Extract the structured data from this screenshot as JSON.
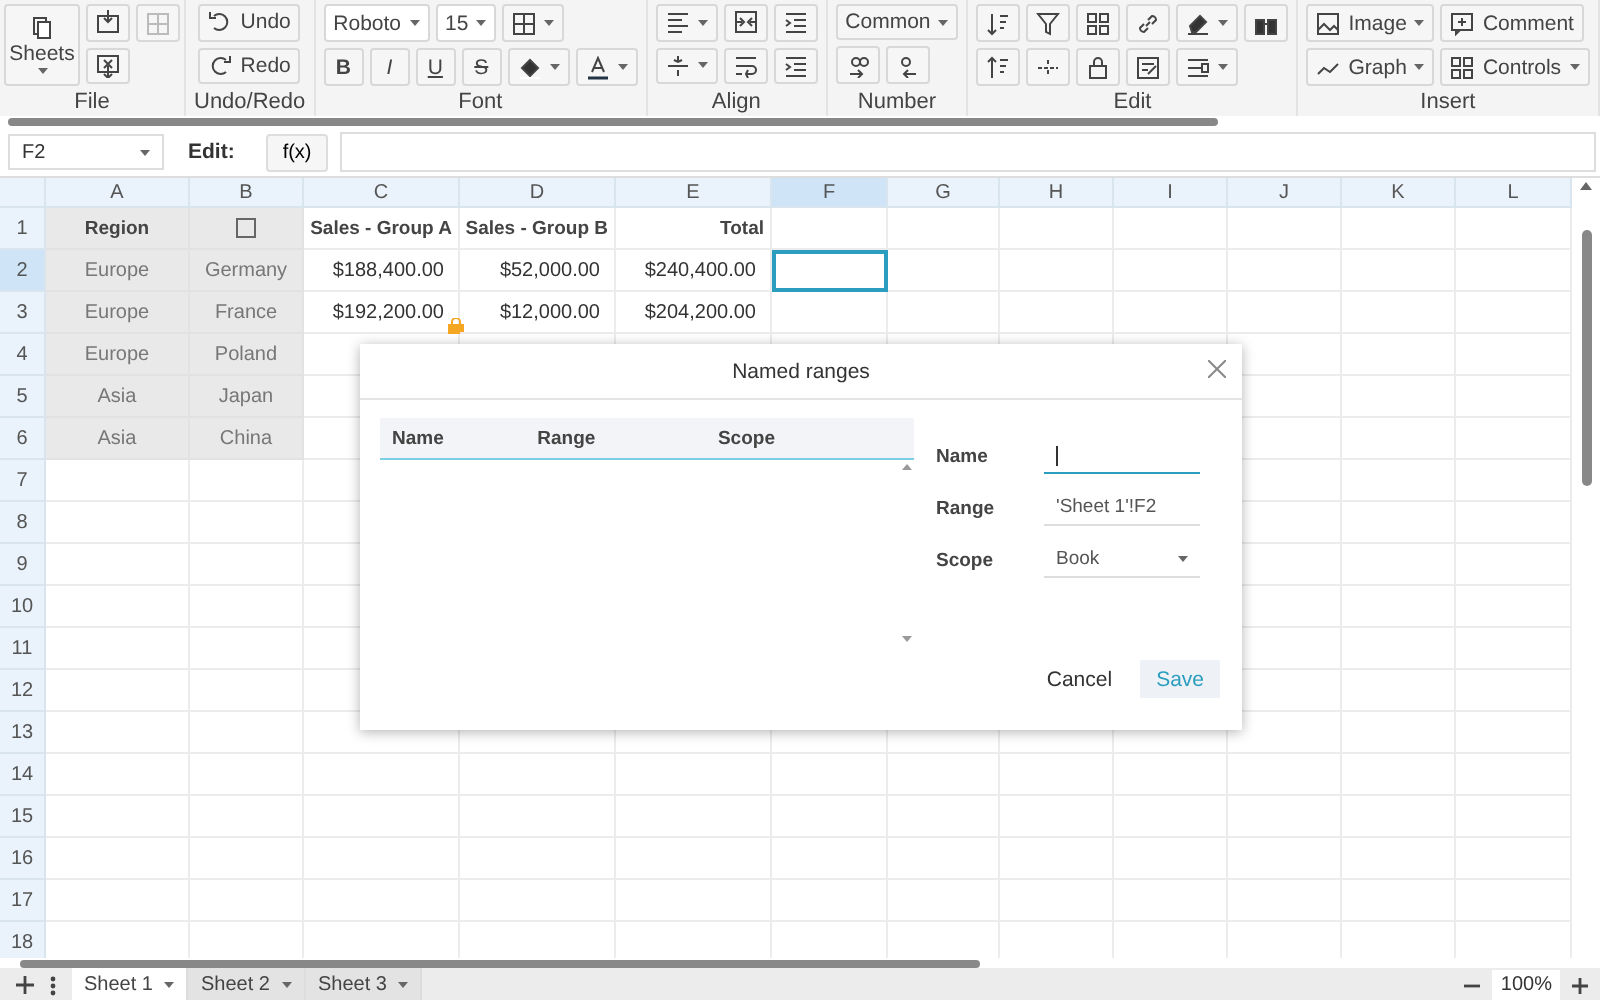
{
  "toolbar": {
    "file": {
      "label": "File",
      "sheets": "Sheets"
    },
    "undo_redo": {
      "label": "Undo/Redo",
      "undo": "Undo",
      "redo": "Redo"
    },
    "font": {
      "label": "Font",
      "family": "Roboto",
      "size": "15",
      "bold": "B",
      "italic": "I",
      "underline": "U",
      "strike": "S"
    },
    "align": {
      "label": "Align"
    },
    "number": {
      "label": "Number",
      "format": "Common"
    },
    "edit": {
      "label": "Edit"
    },
    "insert": {
      "label": "Insert",
      "image": "Image",
      "comment": "Comment",
      "graph": "Graph",
      "controls": "Controls"
    }
  },
  "formula_bar": {
    "cell_ref": "F2",
    "edit_label": "Edit:",
    "function_button": "f(x)"
  },
  "grid": {
    "columns": [
      {
        "label": "A",
        "selected": false
      },
      {
        "label": "B",
        "selected": false
      },
      {
        "label": "C",
        "selected": false
      },
      {
        "label": "D",
        "selected": false
      },
      {
        "label": "E",
        "selected": false
      },
      {
        "label": "F",
        "selected": true
      },
      {
        "label": "G",
        "selected": false
      },
      {
        "label": "H",
        "selected": false
      },
      {
        "label": "I",
        "selected": false
      },
      {
        "label": "J",
        "selected": false
      },
      {
        "label": "K",
        "selected": false
      },
      {
        "label": "L",
        "selected": false
      }
    ],
    "rows": [
      {
        "number": "1",
        "selected": false,
        "cells": [
          {
            "text": "Region",
            "kind": "header"
          },
          {
            "kind": "checkbox",
            "checked": false
          },
          {
            "text": "Sales - Group A",
            "kind": "header"
          },
          {
            "text": "Sales - Group B",
            "kind": "header"
          },
          {
            "text": "Total",
            "kind": "header"
          }
        ]
      },
      {
        "number": "2",
        "selected": true,
        "cells": [
          {
            "text": "Europe"
          },
          {
            "text": "Germany"
          },
          {
            "text": "$188,400.00"
          },
          {
            "text": "$52,000.00"
          },
          {
            "text": "$240,400.00"
          }
        ]
      },
      {
        "number": "3",
        "selected": false,
        "cells": [
          {
            "text": "Europe"
          },
          {
            "text": "France"
          },
          {
            "text": "$192,200.00",
            "locked": true
          },
          {
            "text": "$12,000.00"
          },
          {
            "text": "$204,200.00"
          }
        ]
      },
      {
        "number": "4",
        "selected": false,
        "cells": [
          {
            "text": "Europe"
          },
          {
            "text": "Poland"
          }
        ]
      },
      {
        "number": "5",
        "selected": false,
        "cells": [
          {
            "text": "Asia"
          },
          {
            "text": "Japan"
          }
        ]
      },
      {
        "number": "6",
        "selected": false,
        "cells": [
          {
            "text": "Asia"
          },
          {
            "text": "China"
          }
        ]
      },
      {
        "number": "7",
        "selected": false,
        "cells": []
      },
      {
        "number": "8",
        "selected": false,
        "cells": []
      },
      {
        "number": "9",
        "selected": false,
        "cells": []
      },
      {
        "number": "10",
        "selected": false,
        "cells": []
      },
      {
        "number": "11",
        "selected": false,
        "cells": []
      },
      {
        "number": "12",
        "selected": false,
        "cells": []
      },
      {
        "number": "13",
        "selected": false,
        "cells": []
      },
      {
        "number": "14",
        "selected": false,
        "cells": []
      },
      {
        "number": "15",
        "selected": false,
        "cells": []
      },
      {
        "number": "16",
        "selected": false,
        "cells": []
      },
      {
        "number": "17",
        "selected": false,
        "cells": []
      },
      {
        "number": "18",
        "selected": false,
        "cells": []
      }
    ]
  },
  "dialog": {
    "title": "Named ranges",
    "table_columns": [
      "Name",
      "Range",
      "Scope"
    ],
    "fields": [
      {
        "label": "Name",
        "kind": "text",
        "focused": true
      },
      {
        "label": "Range",
        "kind": "text",
        "value": "'Sheet 1'!F2",
        "focused": false
      },
      {
        "label": "Scope",
        "kind": "select",
        "value": "Book",
        "focused": false
      }
    ],
    "buttons": [
      {
        "label": "Cancel",
        "primary": false
      },
      {
        "label": "Save",
        "primary": true
      }
    ]
  },
  "sheet_tabs": [
    {
      "label": "Sheet 1",
      "selected": true
    },
    {
      "label": "Sheet 2",
      "selected": false
    },
    {
      "label": "Sheet 3",
      "selected": false
    }
  ],
  "zoom": "100%"
}
